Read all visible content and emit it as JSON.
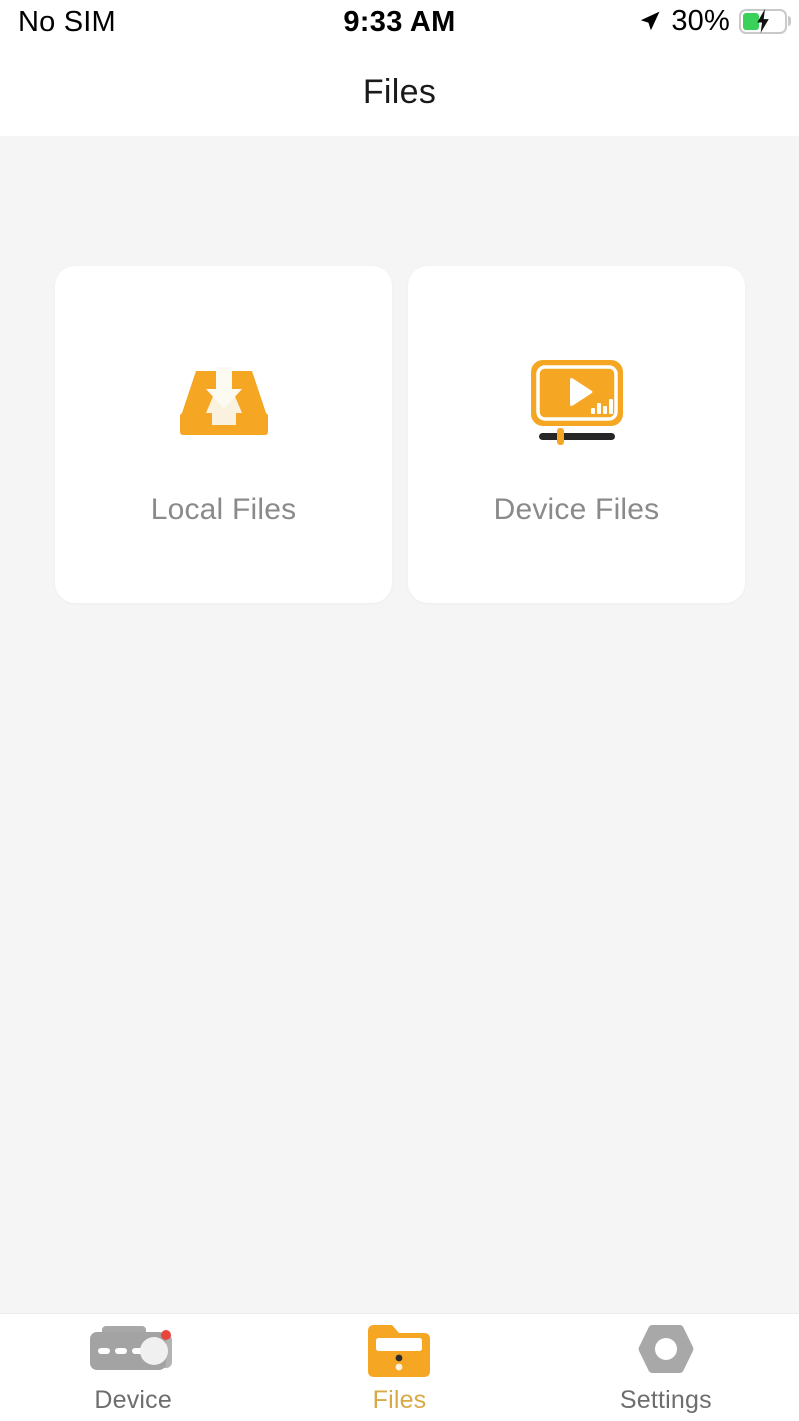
{
  "status_bar": {
    "carrier": "No SIM",
    "time": "9:33 AM",
    "battery_percent": "30%",
    "location_icon": "location-arrow-icon",
    "battery_icon": "battery-charging-icon",
    "battery_level": 30,
    "battery_color": "#3ad15a",
    "charging": true
  },
  "header": {
    "title": "Files"
  },
  "main": {
    "cards": [
      {
        "label": "Local Files",
        "icon": "inbox-download-icon",
        "icon_color": "#f5a623"
      },
      {
        "label": "Device Files",
        "icon": "video-player-icon",
        "icon_color": "#f5a623"
      }
    ]
  },
  "tab_bar": {
    "active": "Files",
    "active_color": "#d8a945",
    "inactive_color": "#6e6e6e",
    "items": [
      {
        "label": "Device",
        "icon": "dashcam-icon",
        "active": false
      },
      {
        "label": "Files",
        "icon": "folder-icon",
        "active": true
      },
      {
        "label": "Settings",
        "icon": "hex-nut-icon",
        "active": false
      }
    ]
  },
  "theme": {
    "accent": "#f5a623",
    "background": "#f5f5f5",
    "surface": "#ffffff"
  }
}
